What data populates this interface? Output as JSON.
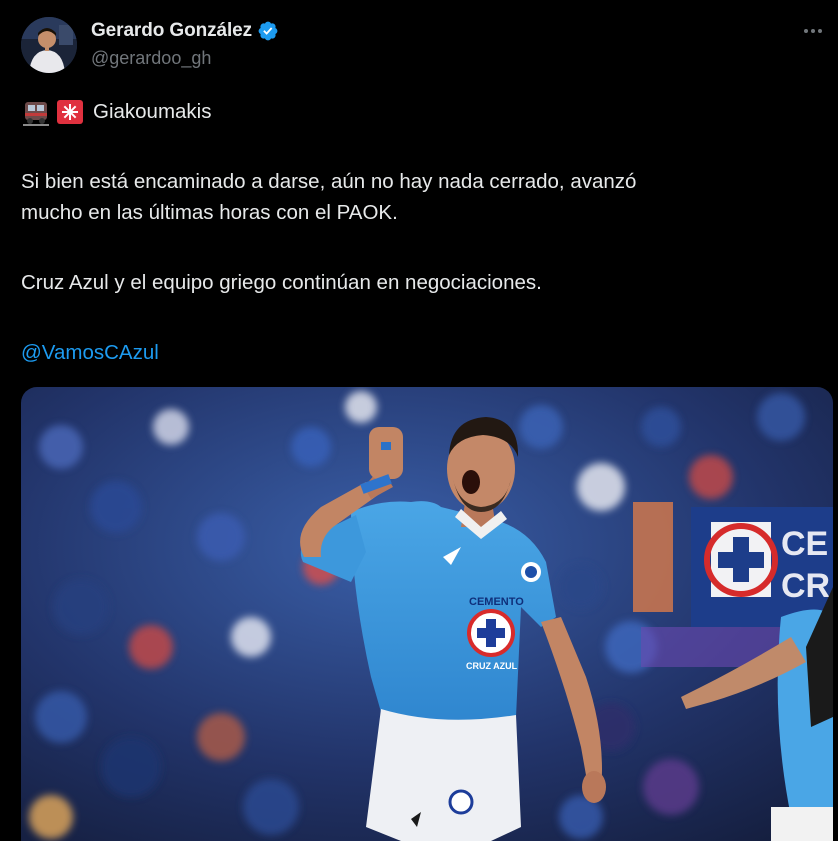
{
  "author": {
    "display_name": "Gerardo González",
    "handle": "@gerardoo_gh",
    "verified": true,
    "avatar_icon": "user-avatar"
  },
  "header": {
    "more_icon": "ellipsis-icon"
  },
  "tweet": {
    "emoji": [
      "train-emoji",
      "siren-emoji"
    ],
    "title": "Giakoumakis",
    "paragraph1_line1": "Si bien está encaminado a darse, aún no hay nada cerrado, avanzó",
    "paragraph1_line2": "mucho en las últimas horas con el PAOK.",
    "paragraph2": "Cruz Azul y el equipo griego continúan en negociaciones.",
    "mention": "@VamosCAzul"
  },
  "media": {
    "jersey_sponsor": "CEMENTO",
    "jersey_club": "CRUZ AZUL",
    "banner_text": "CE",
    "banner_text2": "CR"
  },
  "colors": {
    "background": "#000000",
    "text": "#e7e9ea",
    "secondary": "#71767b",
    "link": "#1d9bf0",
    "verified": "#1d9bf0"
  }
}
